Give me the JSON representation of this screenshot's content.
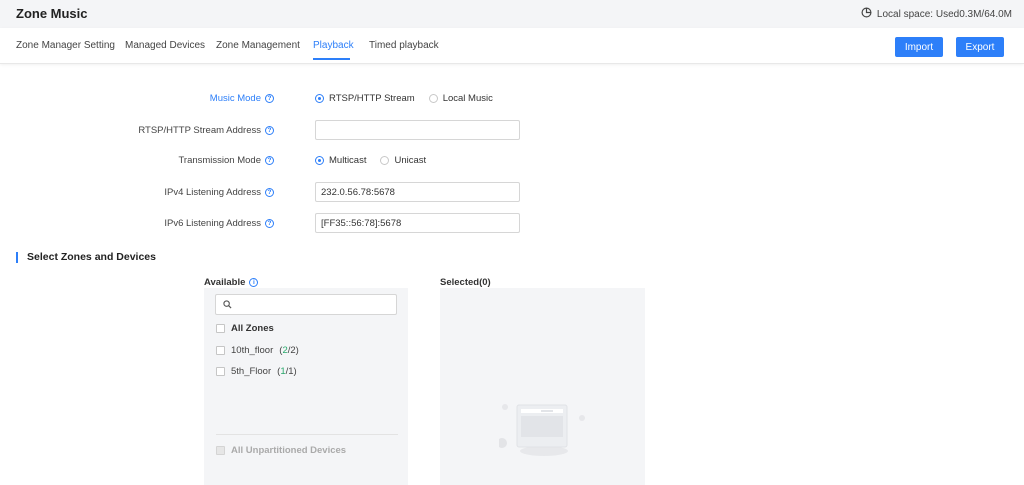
{
  "header": {
    "title": "Zone Music",
    "storage_text": "Local space: Used0.3M/64.0M"
  },
  "tabs": [
    {
      "label": "Zone Manager Setting"
    },
    {
      "label": "Managed Devices"
    },
    {
      "label": "Zone Management"
    },
    {
      "label": "Playback"
    },
    {
      "label": "Timed playback"
    }
  ],
  "active_tab": "Playback",
  "actions": {
    "import_label": "Import",
    "export_label": "Export"
  },
  "form": {
    "music_mode": {
      "label": "Music Mode",
      "options": [
        "RTSP/HTTP Stream",
        "Local Music"
      ],
      "selected": "RTSP/HTTP Stream"
    },
    "stream_address": {
      "label": "RTSP/HTTP Stream Address",
      "value": ""
    },
    "transmission_mode": {
      "label": "Transmission Mode",
      "options": [
        "Multicast",
        "Unicast"
      ],
      "selected": "Multicast"
    },
    "ipv4_address": {
      "label": "IPv4 Listening Address",
      "value": "232.0.56.78:5678"
    },
    "ipv6_address": {
      "label": "IPv6 Listening Address",
      "value": "[FF35::56:78]:5678"
    }
  },
  "zones_section": {
    "title": "Select Zones and Devices",
    "available": {
      "title": "Available",
      "search_value": "",
      "all_zones_label": "All Zones",
      "zones": [
        {
          "name": "10th_floor",
          "count_selected": "2",
          "count_total": "2"
        },
        {
          "name": "5th_Floor",
          "count_selected": "1",
          "count_total": "1"
        }
      ],
      "unpartitioned_label": "All Unpartitioned Devices"
    },
    "selected": {
      "title": "Selected(0)"
    }
  },
  "colors": {
    "accent": "#2d7ff9",
    "count_green": "#27a86b",
    "panel_bg": "#f4f5f7",
    "topbar_bg": "#f4f5f7"
  }
}
